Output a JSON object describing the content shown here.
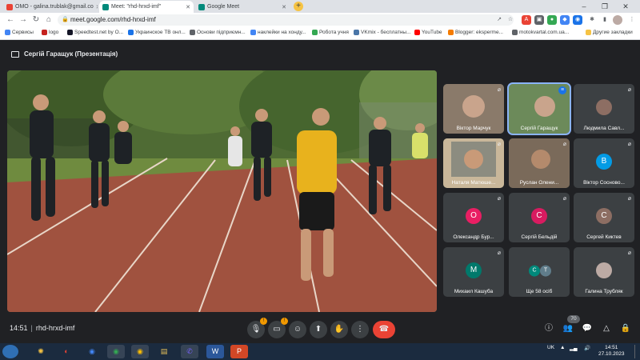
{
  "browser": {
    "tabs": [
      {
        "title": "ОМО - galina.trublak@gmail.co",
        "favicon_color": "#ea4335",
        "active": false
      },
      {
        "title": "Meet: \"rhd-hrxd-imf\"",
        "favicon_color": "#00897b",
        "active": true
      },
      {
        "title": "Google Meet",
        "favicon_color": "#00897b",
        "active": false
      }
    ],
    "new_tab": "+",
    "address": "meet.google.com/rhd-hrxd-imf",
    "bookmarks": [
      {
        "label": "Сервисы",
        "color": "#4285f4"
      },
      {
        "label": "logo",
        "color": "#c5221f"
      },
      {
        "label": "Speedtest.net by O...",
        "color": "#141526"
      },
      {
        "label": "Украинское ТВ онл...",
        "color": "#1a73e8"
      },
      {
        "label": "Основи підприємн...",
        "color": "#5f6368"
      },
      {
        "label": "наклейки на хонду...",
        "color": "#4285f4"
      },
      {
        "label": "Робота учня",
        "color": "#34a853"
      },
      {
        "label": "VKmix - бесплатны...",
        "color": "#4a76a8"
      },
      {
        "label": "YouTube",
        "color": "#ff0000"
      },
      {
        "label": "Blogger: eksperme...",
        "color": "#f57c00"
      },
      {
        "label": "motokvartal.com.ua...",
        "color": "#5f6368"
      },
      {
        "label": "Другие закладки",
        "color": "#f6c344"
      }
    ]
  },
  "meet": {
    "presenter_label": "Сергій Гаращук (Презентація)",
    "participants": [
      {
        "name": "Віктор Марчук",
        "type": "camera",
        "speaking": false
      },
      {
        "name": "Сергій Гаращук",
        "type": "camera",
        "speaking": true
      },
      {
        "name": "Людмила Савл...",
        "type": "photo",
        "initial": "",
        "color": "#8d6e63"
      },
      {
        "name": "Наталя Матюше...",
        "type": "camera",
        "speaking": false
      },
      {
        "name": "Руслан Олени...",
        "type": "camera",
        "speaking": false
      },
      {
        "name": "Віктор Сосново...",
        "type": "avatar",
        "initial": "B",
        "color": "#039be5"
      },
      {
        "name": "Олександр Бур...",
        "type": "avatar",
        "initial": "O",
        "color": "#e91e63"
      },
      {
        "name": "Сергій Бельдій",
        "type": "avatar",
        "initial": "C",
        "color": "#d81b60"
      },
      {
        "name": "Сергей Киктев",
        "type": "avatar",
        "initial": "C",
        "color": "#8d6e63"
      },
      {
        "name": "Михаил Кашуба",
        "type": "avatar",
        "initial": "M",
        "color": "#00796b"
      },
      {
        "name": "Ще 58 осіб",
        "type": "more",
        "initials": [
          "C",
          "T"
        ],
        "colors": [
          "#00897b",
          "#607d8b"
        ]
      },
      {
        "name": "Галина Трубляк",
        "type": "photo",
        "initial": "",
        "color": "#bcaaa4"
      }
    ],
    "time": "14:51",
    "meeting_code": "rhd-hrxd-imf",
    "participant_count": "70",
    "controls": {
      "mic_warning": "!",
      "cam_warning": "!"
    }
  },
  "taskbar": {
    "language": "UK",
    "time": "14:51",
    "date": "27.10.2023",
    "apps": [
      {
        "name": "explorer",
        "label": "",
        "color": "#f6c344"
      },
      {
        "name": "yandex",
        "label": "",
        "color": "#ea4335"
      },
      {
        "name": "chrome",
        "label": "",
        "color": "#4285f4"
      },
      {
        "name": "chrome-2",
        "label": "",
        "color": "#34a853"
      },
      {
        "name": "chrome-3",
        "label": "",
        "color": "#fbbc04"
      },
      {
        "name": "files",
        "label": "",
        "color": "#e6c15a"
      },
      {
        "name": "viber",
        "label": "",
        "color": "#7360f2"
      },
      {
        "name": "word",
        "label": "W",
        "color": "#2b579a"
      },
      {
        "name": "powerpoint",
        "label": "P",
        "color": "#d24726"
      }
    ]
  }
}
